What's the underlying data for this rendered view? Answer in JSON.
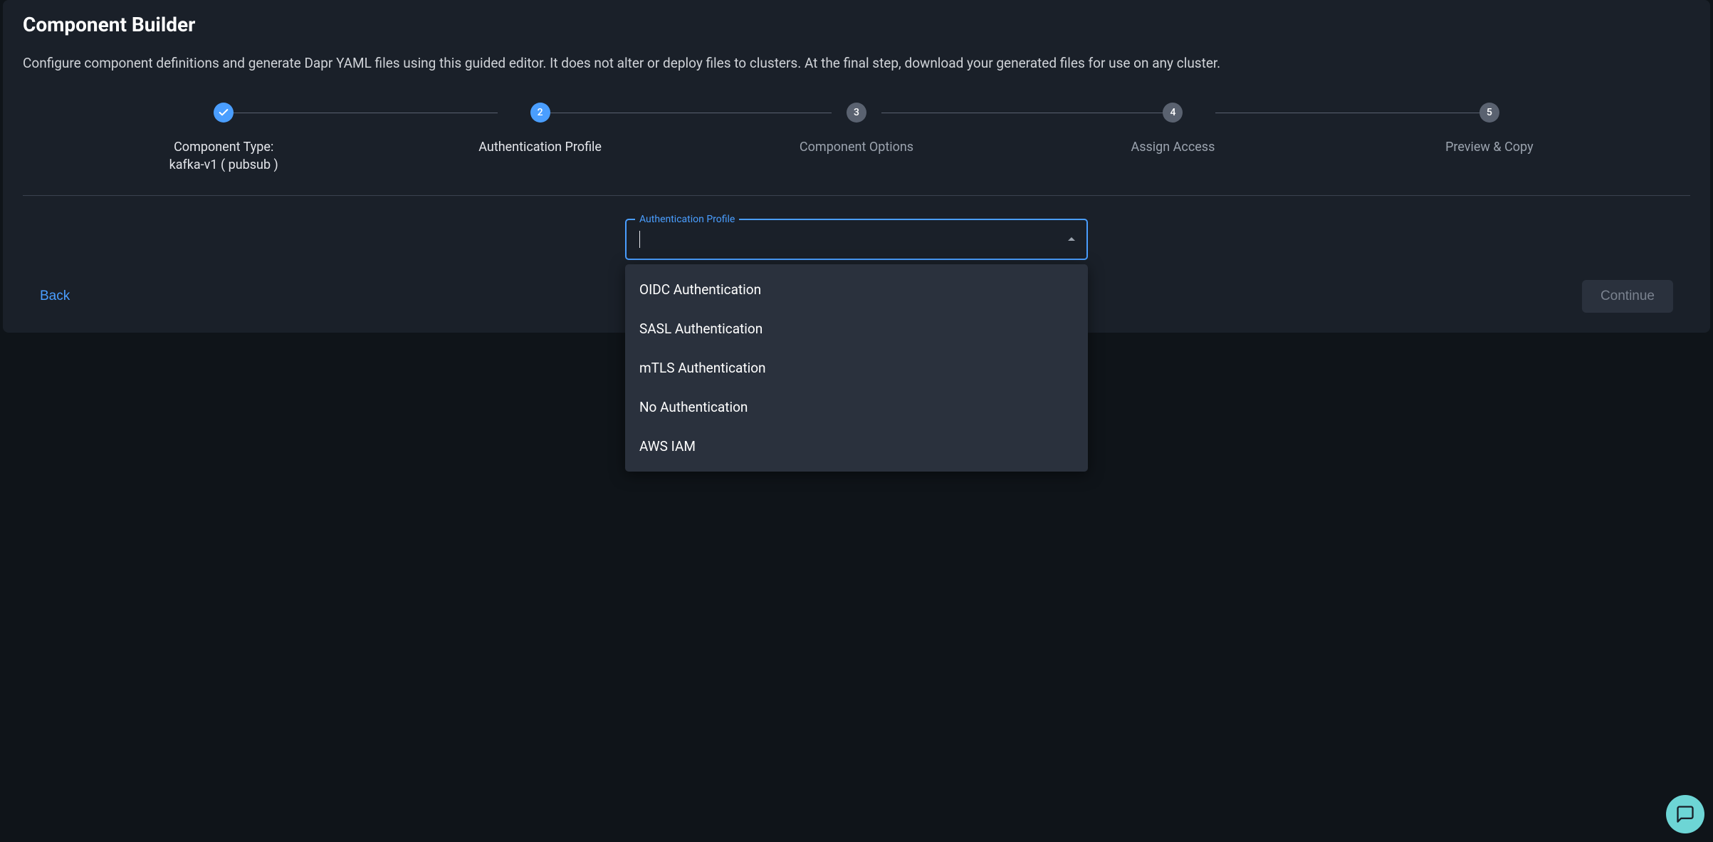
{
  "header": {
    "title": "Component Builder",
    "description": "Configure component definitions and generate Dapr YAML files using this guided editor. It does not alter or deploy files to clusters. At the final step, download your generated files for use on any cluster."
  },
  "stepper": {
    "steps": [
      {
        "label": "Component Type:",
        "sublabel": "kafka-v1 ( pubsub )",
        "state": "completed"
      },
      {
        "label": "Authentication Profile",
        "number": "2",
        "state": "active"
      },
      {
        "label": "Component Options",
        "number": "3",
        "state": "pending"
      },
      {
        "label": "Assign Access",
        "number": "4",
        "state": "pending"
      },
      {
        "label": "Preview & Copy",
        "number": "5",
        "state": "pending"
      }
    ]
  },
  "form": {
    "select": {
      "label": "Authentication Profile",
      "value": "",
      "options": [
        "OIDC Authentication",
        "SASL Authentication",
        "mTLS Authentication",
        "No Authentication",
        "AWS IAM"
      ]
    }
  },
  "footer": {
    "back_label": "Back",
    "continue_label": "Continue"
  }
}
